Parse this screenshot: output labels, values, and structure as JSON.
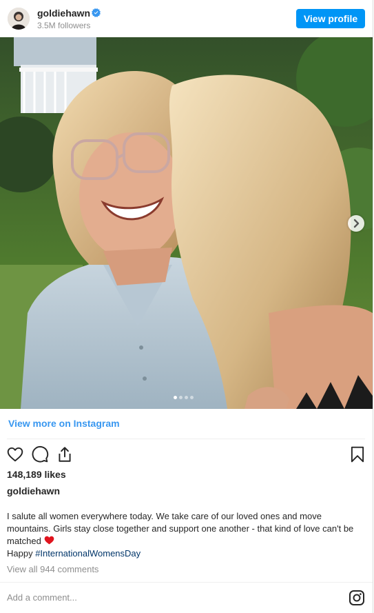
{
  "header": {
    "username": "goldiehawn",
    "followers": "3.5M followers",
    "view_profile_label": "View profile"
  },
  "post": {
    "image_icon": "photo",
    "carousel": {
      "count": 4,
      "active": 1
    }
  },
  "view_more_label": "View more on Instagram",
  "actions": {
    "like_icon": "heart-icon",
    "comment_icon": "comment-icon",
    "share_icon": "share-icon",
    "save_icon": "bookmark-icon"
  },
  "likes": "148,189 likes",
  "caption": {
    "username": "goldiehawn",
    "line1": "I salute all women everywhere today. We take care of our loved ones and move mountains. Girls stay close together and support one another - that kind of love can't be matched",
    "line2_prefix": "Happy ",
    "hashtag": "#InternationalWomensDay"
  },
  "comments_link": "View all 944 comments",
  "add_comment_placeholder": "Add a comment...",
  "colors": {
    "accent": "#0095f6",
    "link": "#3897f0",
    "muted": "#8e8e8e",
    "text": "#262626",
    "heart": "#e0141e"
  }
}
